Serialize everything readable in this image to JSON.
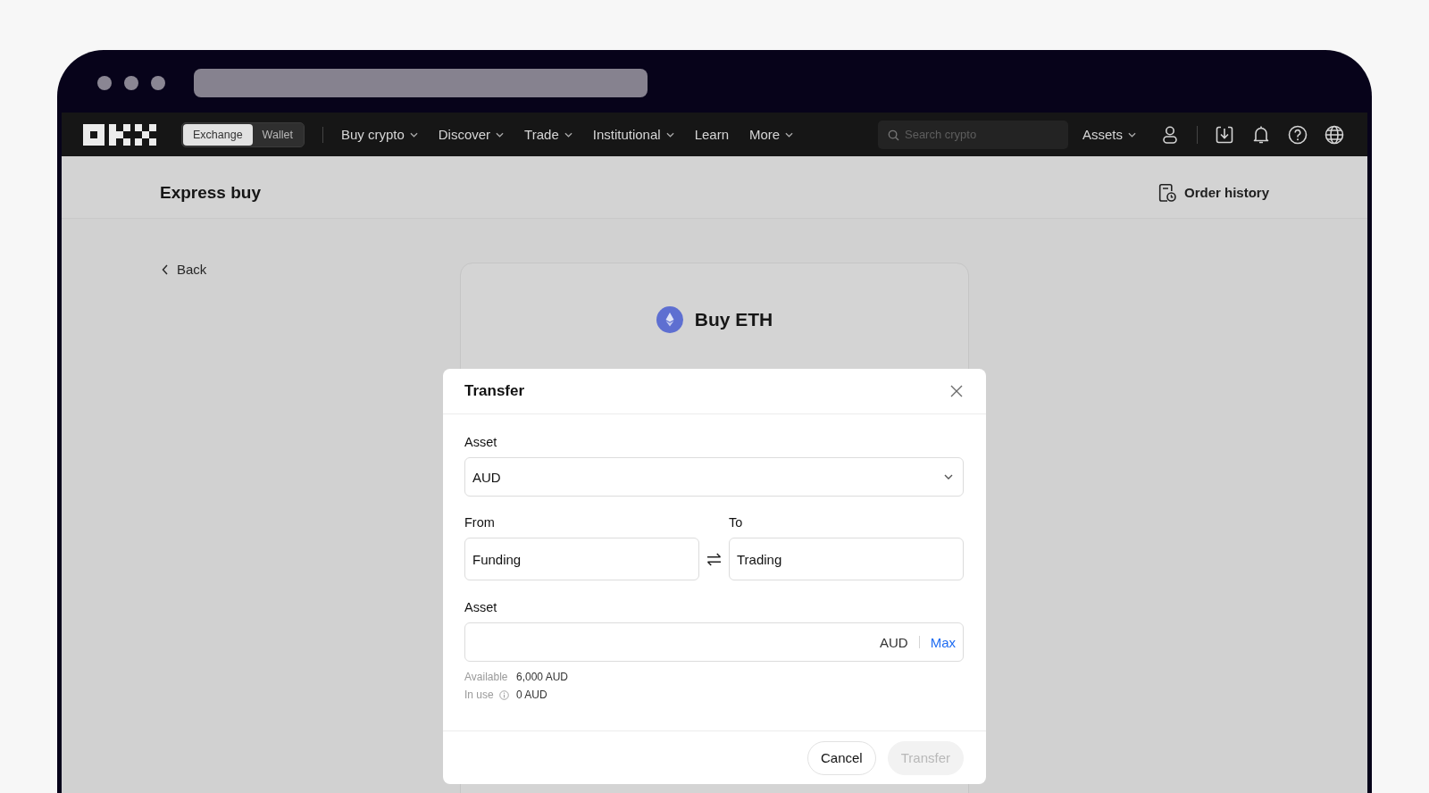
{
  "navbar": {
    "mode_tabs": [
      {
        "label": "Exchange",
        "selected": true
      },
      {
        "label": "Wallet",
        "selected": false
      }
    ],
    "menu": [
      {
        "label": "Buy crypto",
        "dropdown": true
      },
      {
        "label": "Discover",
        "dropdown": true
      },
      {
        "label": "Trade",
        "dropdown": true
      },
      {
        "label": "Institutional",
        "dropdown": true
      },
      {
        "label": "Learn",
        "dropdown": false
      },
      {
        "label": "More",
        "dropdown": true
      }
    ],
    "search": {
      "placeholder": "Search crypto"
    },
    "assets": {
      "label": "Assets",
      "dropdown": true
    }
  },
  "page_header": {
    "title": "Express buy",
    "order_history": "Order history"
  },
  "back": {
    "label": "Back"
  },
  "card": {
    "title": "Buy ETH"
  },
  "dialog": {
    "title": "Transfer",
    "asset_label": "Asset",
    "asset_value": "AUD",
    "from_label": "From",
    "from_value": "Funding",
    "to_label": "To",
    "to_value": "Trading",
    "amount_label": "Asset",
    "amount_unit": "AUD",
    "max": "Max",
    "balances": [
      {
        "kind": "plain",
        "label": "Available",
        "value": "6,000 AUD"
      },
      {
        "kind": "info",
        "label": "In use",
        "value": "0 AUD"
      }
    ],
    "buttons": [
      {
        "label": "Cancel",
        "disabled": false
      },
      {
        "label": "Transfer",
        "disabled": true
      }
    ]
  }
}
